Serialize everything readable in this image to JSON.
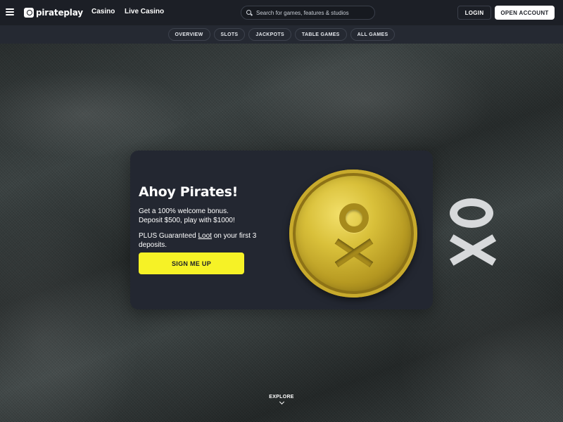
{
  "header": {
    "logo_text": "pirateplay",
    "nav": [
      "Casino",
      "Live Casino"
    ],
    "search_placeholder": "Search for games, features & studios",
    "login_label": "LOGIN",
    "open_account_label": "OPEN ACCOUNT"
  },
  "subnav": {
    "items": [
      "OVERVIEW",
      "SLOTS",
      "JACKPOTS",
      "TABLE GAMES",
      "ALL GAMES"
    ]
  },
  "promo": {
    "title": "Ahoy Pirates!",
    "line1": "Get a 100% welcome bonus.",
    "line2": "Deposit $500, play with $1000!",
    "line3_pre": "PLUS Guaranteed ",
    "line3_link": "Loot",
    "line3_post": " on your first 3",
    "line4": "deposits.",
    "cta_label": "SIGN ME UP"
  },
  "explore_label": "EXPLORE",
  "colors": {
    "topbar": "#1c1f26",
    "subnav": "#252932",
    "card": "#232731",
    "cta": "#f6f226"
  }
}
